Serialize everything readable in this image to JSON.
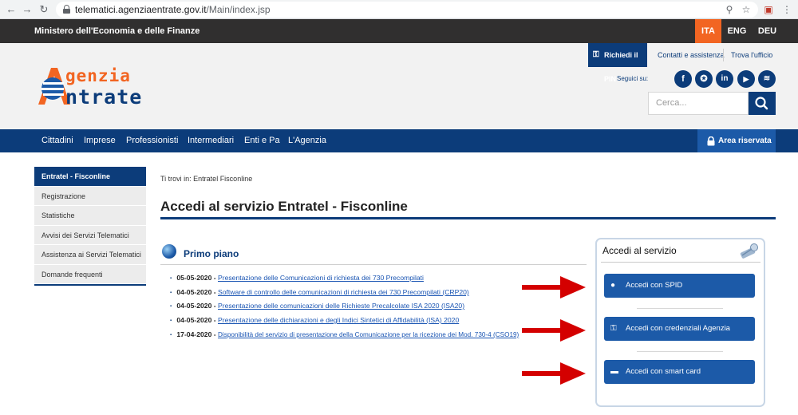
{
  "browser": {
    "url_host": "telematici.agenziaentrate.gov.it",
    "url_path": "/Main/index.jsp"
  },
  "topbar": {
    "ministry": "Ministero dell'Economia e delle Finanze",
    "languages": [
      "ITA",
      "ENG",
      "DEU"
    ],
    "active_language": "ITA"
  },
  "header": {
    "pin_label": "Richiedi il PIN",
    "contacts_label": "Contatti e assistenza",
    "office_label": "Trova l'ufficio",
    "logo_line1": "genzia",
    "logo_line2": "ntrate",
    "follow_label": "Seguici su:",
    "social": [
      "facebook-icon",
      "twitter-icon",
      "linkedin-icon",
      "youtube-icon",
      "rss-icon"
    ],
    "search_placeholder": "Cerca..."
  },
  "main_nav": {
    "items": [
      "Cittadini",
      "Imprese",
      "Professionisti",
      "Intermediari",
      "Enti e Pa",
      "L'Agenzia"
    ],
    "reserved_area": "Area riservata"
  },
  "sidebar": {
    "items": [
      "Entratel - Fisconline",
      "Registrazione",
      "Statistiche",
      "Avvisi dei Servizi Telematici",
      "Assistenza ai Servizi Telematici",
      "Domande frequenti"
    ]
  },
  "content": {
    "breadcrumb": "Ti trovi in: Entratel Fisconline",
    "title": "Accedi al servizio Entratel - Fisconline",
    "primo_piano": "Primo piano",
    "news": [
      {
        "date": "05-05-2020 -",
        "text": "Presentazione delle Comunicazioni di richiesta dei 730 Precompilati"
      },
      {
        "date": "04-05-2020 -",
        "text": "Software di controllo delle comunicazioni di richiesta dei 730 Precompilati (CRP20)"
      },
      {
        "date": "04-05-2020 -",
        "text": "Presentazione delle comunicazioni delle Richieste Precalcolate ISA 2020 (ISA20)"
      },
      {
        "date": "04-05-2020 -",
        "text": "Presentazione delle dichiarazioni e degli Indici Sintetici di Affidabilità (ISA) 2020"
      },
      {
        "date": "17-04-2020 -",
        "text": "Disponibilità del servizio di presentazione della Comunicazione per la ricezione dei Mod. 730-4 (CSO19)"
      }
    ]
  },
  "access": {
    "title": "Accedi al servizio",
    "spid": "Accedi con SPID",
    "credentials": "Accedi con credenziali Agenzia",
    "smartcard": "Accedi con smart card"
  },
  "colors": {
    "brand_blue": "#0c3c7a",
    "button_blue": "#1c5aa8",
    "accent_orange": "#f26522",
    "arrow_red": "#d40000"
  }
}
